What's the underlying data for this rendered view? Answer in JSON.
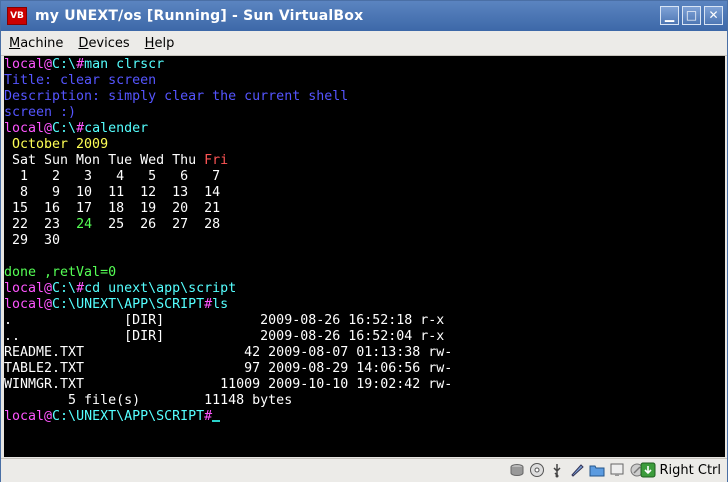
{
  "window": {
    "title": "my UNEXT/os [Running] - Sun VirtualBox",
    "icon_label": "VB",
    "controls": {
      "minimize": "▁",
      "maximize": "□",
      "close": "✕"
    }
  },
  "menu": [
    "Machine",
    "Devices",
    "Help"
  ],
  "colors": {
    "prompt": "#ff55ff",
    "path": "#55ffff",
    "command": "#55ffff",
    "info": "#5555ff",
    "calendar_title": "#ffff55",
    "text": "#ffffff",
    "friday": "#ff5555",
    "today": "#55ff55",
    "done": "#55ff55",
    "cursor": "#2ad0c8"
  },
  "terminal": {
    "lines": [
      [
        [
          "local@",
          "prompt"
        ],
        [
          "C:\\",
          "path"
        ],
        [
          "#",
          "prompt"
        ],
        [
          "man clrscr",
          "command"
        ]
      ],
      [
        [
          "Title: clear screen",
          "info"
        ]
      ],
      [
        [
          "Description: simply clear the current shell",
          "info"
        ]
      ],
      [
        [
          "screen :)",
          "info"
        ]
      ],
      [
        [
          "local@",
          "prompt"
        ],
        [
          "C:\\",
          "path"
        ],
        [
          "#",
          "prompt"
        ],
        [
          "calender",
          "command"
        ]
      ],
      [
        [
          " October 2009",
          "calendar_title"
        ]
      ],
      [
        [
          " Sat Sun Mon Tue Wed Thu ",
          "text"
        ],
        [
          "Fri",
          "friday"
        ]
      ],
      [
        [
          "  1   2   3   4   5   6   7",
          "text"
        ]
      ],
      [
        [
          "  8   9  10  11  12  13  14",
          "text"
        ]
      ],
      [
        [
          " 15  16  17  18  19  20  21",
          "text"
        ]
      ],
      [
        [
          " 22  23  ",
          "text"
        ],
        [
          "24",
          "today"
        ],
        [
          "  25  26  27  28",
          "text"
        ]
      ],
      [
        [
          " 29  30",
          "text"
        ]
      ],
      [
        [
          "",
          "text"
        ]
      ],
      [
        [
          "done ,retVal=0",
          "done"
        ]
      ],
      [
        [
          "local@",
          "prompt"
        ],
        [
          "C:\\",
          "path"
        ],
        [
          "#",
          "prompt"
        ],
        [
          "cd unext\\app\\script",
          "command"
        ]
      ],
      [
        [
          "local@",
          "prompt"
        ],
        [
          "C:\\UNEXT\\APP\\SCRIPT",
          "path"
        ],
        [
          "#",
          "prompt"
        ],
        [
          "ls",
          "command"
        ]
      ],
      [
        [
          ".              [DIR]            2009-08-26 16:52:18 r-x",
          "text"
        ]
      ],
      [
        [
          "..             [DIR]            2009-08-26 16:52:04 r-x",
          "text"
        ]
      ],
      [
        [
          "README.TXT                    42 2009-08-07 01:13:38 rw-",
          "text"
        ]
      ],
      [
        [
          "TABLE2.TXT                    97 2009-08-29 14:06:56 rw-",
          "text"
        ]
      ],
      [
        [
          "WINMGR.TXT                 11009 2009-10-10 19:02:42 rw-",
          "text"
        ]
      ],
      [
        [
          "        5 file(s)        11148 bytes",
          "text"
        ]
      ],
      [
        [
          "local@",
          "prompt"
        ],
        [
          "C:\\UNEXT\\APP\\SCRIPT",
          "path"
        ],
        [
          "#",
          "prompt"
        ]
      ]
    ]
  },
  "statusbar": {
    "icons": [
      "hard-disk-icon",
      "cd-drive-icon",
      "usb-icon",
      "network-icon",
      "shared-folder-icon",
      "display-icon",
      "mouse-integration-icon"
    ],
    "host_key_label": "Right Ctrl"
  }
}
